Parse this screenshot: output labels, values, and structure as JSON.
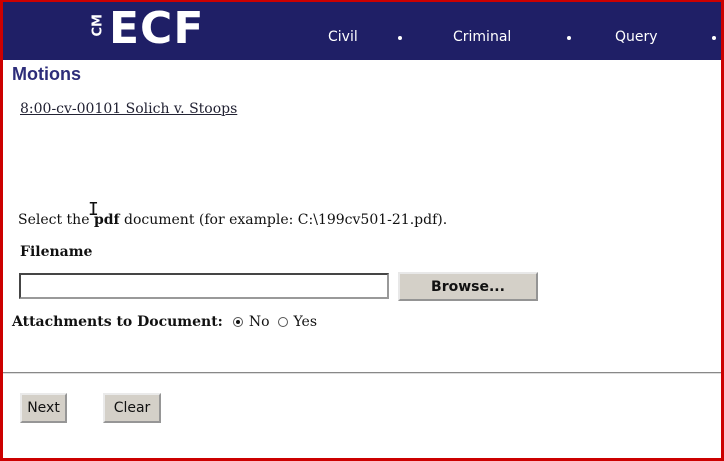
{
  "header": {
    "logo_prefix": "CM",
    "logo_main": "ECF",
    "nav": [
      {
        "label": "Civil"
      },
      {
        "label": "Criminal"
      },
      {
        "label": "Query"
      }
    ]
  },
  "page": {
    "title": "Motions",
    "case_link": "8:00-cv-00101 Solich v. Stoops"
  },
  "form": {
    "instruction_prefix": "Select the ",
    "instruction_bold": "pdf",
    "instruction_suffix": " document (for example: C:\\199cv501-21.pdf).",
    "filename_label": "Filename",
    "filename_value": "",
    "browse_label": "Browse...",
    "attachments_label": "Attachments to Document:",
    "attachments_options": [
      {
        "label": "No",
        "checked": true
      },
      {
        "label": "Yes",
        "checked": false
      }
    ]
  },
  "actions": {
    "next_label": "Next",
    "clear_label": "Clear"
  },
  "colors": {
    "navbar": "#1f1f66",
    "border_accent": "#cc0000",
    "title": "#2d2d7a"
  }
}
